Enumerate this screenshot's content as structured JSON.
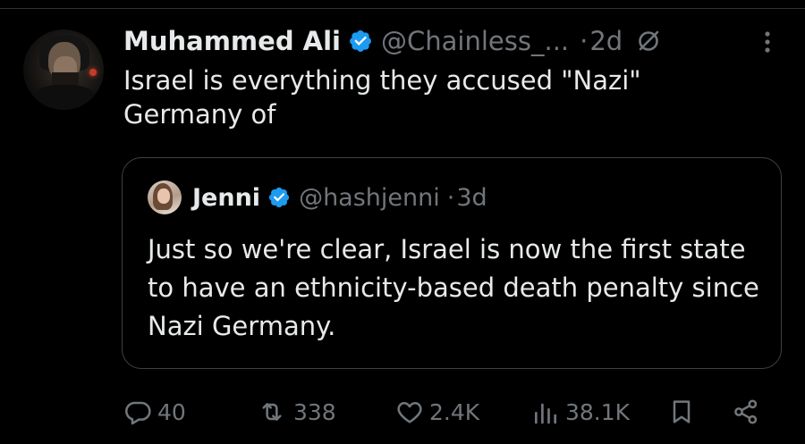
{
  "tweet": {
    "author_name": "Muhammed Ali",
    "handle": "@Chainless_...",
    "separator": "·",
    "time": "2d",
    "text": "Israel is everything they accused \"Nazi\" Germany of"
  },
  "quoted_tweet": {
    "author_name": "Jenni",
    "handle": "@hashjenni",
    "separator": "·",
    "time": "3d",
    "text": "Just so we're clear, Israel is now the first state to have an ethnicity-based death penalty since Nazi Germany."
  },
  "actions": {
    "replies": "40",
    "reposts": "338",
    "likes": "2.4K",
    "views": "38.1K"
  },
  "icons": {
    "verified": "verified-badge-icon",
    "grok": "grok-icon",
    "more": "more-options-icon",
    "reply": "reply-icon",
    "repost": "repost-icon",
    "like": "like-icon",
    "views": "views-icon",
    "bookmark": "bookmark-icon",
    "share": "share-icon"
  },
  "colors": {
    "background": "#000000",
    "text": "#e7e9ea",
    "secondary": "#71767b",
    "verified": "#1d9bf0",
    "border": "#3e4144"
  }
}
